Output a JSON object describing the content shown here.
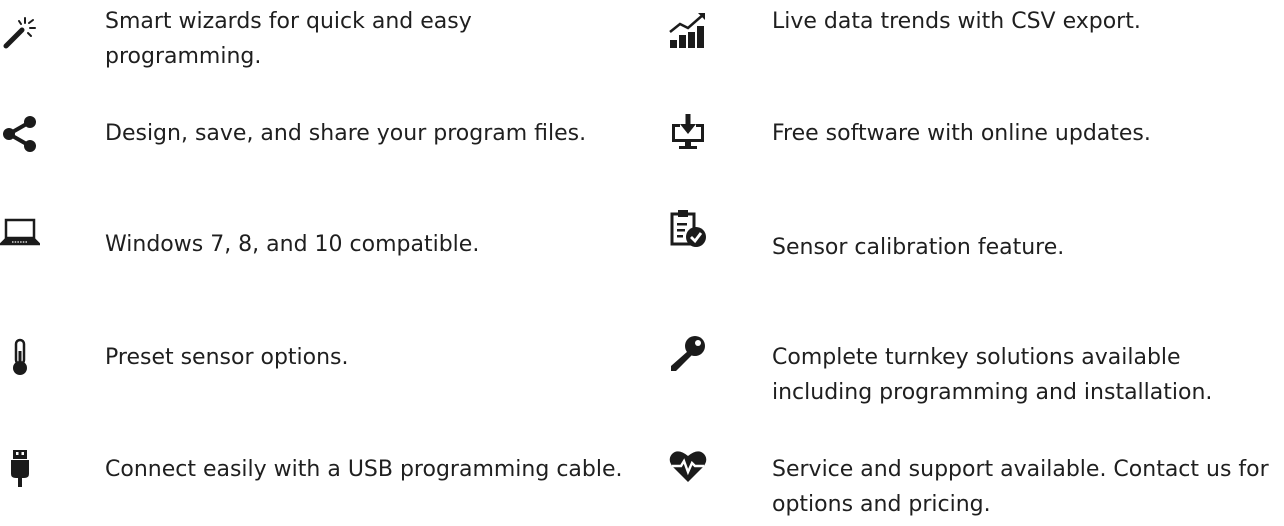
{
  "features_left": [
    {
      "icon": "magic-wand-icon",
      "text": "Smart wizards for quick and easy programming."
    },
    {
      "icon": "share-icon",
      "text": "Design, save, and share your program files."
    },
    {
      "icon": "laptop-icon",
      "text": "Windows 7, 8, and 10 compatible."
    },
    {
      "icon": "thermometer-icon",
      "text": "Preset sensor options."
    },
    {
      "icon": "usb-plug-icon",
      "text": "Connect easily with a USB programming cable."
    }
  ],
  "features_right": [
    {
      "icon": "trend-chart-icon",
      "text": "Live data trends with CSV export."
    },
    {
      "icon": "monitor-download-icon",
      "text": "Free software with online updates."
    },
    {
      "icon": "clipboard-check-icon",
      "text": "Sensor calibration feature."
    },
    {
      "icon": "key-icon",
      "text": "Complete turnkey solutions available including programming and installation."
    },
    {
      "icon": "heartbeat-icon",
      "text": "Service and support available. Contact us for options and pricing."
    }
  ],
  "colors": {
    "icon": "#1b1b1b",
    "text": "#1f1f1f",
    "background": "#ffffff"
  }
}
